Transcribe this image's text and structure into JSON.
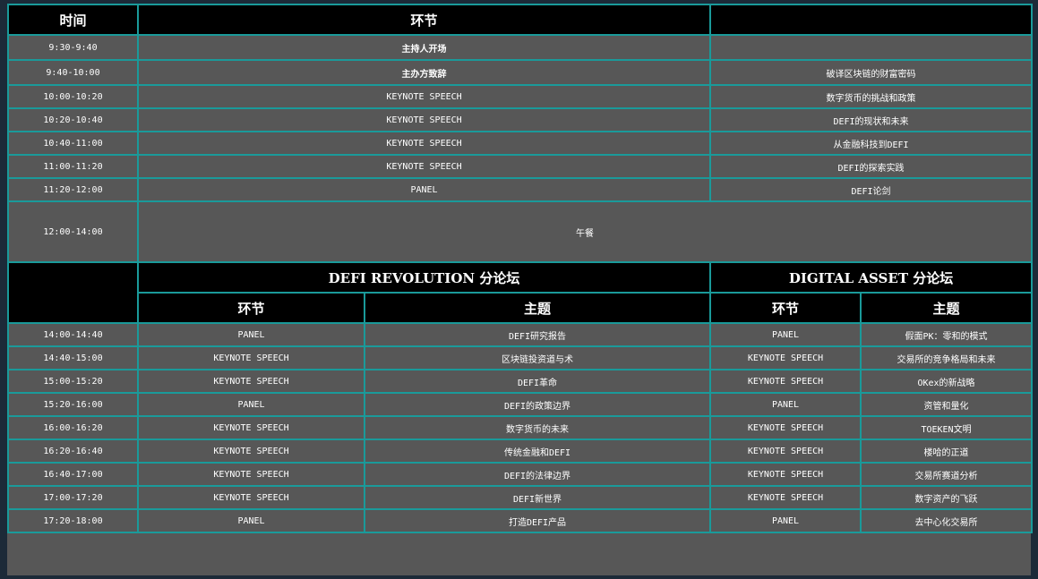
{
  "header": {
    "time": "时间",
    "segment": "环节",
    "topic": ""
  },
  "morning": [
    {
      "time": "9:30-9:40",
      "segment": "主持人开场",
      "topic": ""
    },
    {
      "time": "9:40-10:00",
      "segment": "主办方致辞",
      "topic": "破译区块链的财富密码"
    },
    {
      "time": "10:00-10:20",
      "segment": "KEYNOTE SPEECH",
      "topic": "数字货币的挑战和政策"
    },
    {
      "time": "10:20-10:40",
      "segment": "KEYNOTE SPEECH",
      "topic": "DEFI的现状和未来"
    },
    {
      "time": "10:40-11:00",
      "segment": "KEYNOTE SPEECH",
      "topic": "从金融科技到DEFI"
    },
    {
      "time": "11:00-11:20",
      "segment": "KEYNOTE SPEECH",
      "topic": "DEFI的探索实践"
    },
    {
      "time": "11:20-12:00",
      "segment": "PANEL",
      "topic": "DEFI论剑"
    }
  ],
  "lunch": {
    "time": "12:00-14:00",
    "label": "午餐"
  },
  "forums": {
    "left_title": "DEFI REVOLUTION 分论坛",
    "right_title": "DIGITAL  ASSET  分论坛",
    "segment_label": "环节",
    "topic_label": "主题"
  },
  "afternoon": [
    {
      "time": "14:00-14:40",
      "l_seg": "PANEL",
      "l_topic": "DEFI研究报告",
      "r_seg": "PANEL",
      "r_topic": "假面PK：零和的模式"
    },
    {
      "time": "14:40-15:00",
      "l_seg": "KEYNOTE SPEECH",
      "l_topic": "区块链投资道与术",
      "r_seg": "KEYNOTE SPEECH",
      "r_topic": "交易所的竞争格局和未来"
    },
    {
      "time": "15:00-15:20",
      "l_seg": "KEYNOTE SPEECH",
      "l_topic": "DEFI革命",
      "r_seg": "KEYNOTE SPEECH",
      "r_topic": "OKex的新战略"
    },
    {
      "time": "15:20-16:00",
      "l_seg": "PANEL",
      "l_topic": "DEFI的政策边界",
      "r_seg": "PANEL",
      "r_topic": "资管和量化"
    },
    {
      "time": "16:00-16:20",
      "l_seg": "KEYNOTE SPEECH",
      "l_topic": "数字货币的未来",
      "r_seg": "KEYNOTE SPEECH",
      "r_topic": "TOEKEN文明"
    },
    {
      "time": "16:20-16:40",
      "l_seg": "KEYNOTE SPEECH",
      "l_topic": "传统金融和DEFI",
      "r_seg": "KEYNOTE SPEECH",
      "r_topic": "楼哈的正道"
    },
    {
      "time": "16:40-17:00",
      "l_seg": "KEYNOTE SPEECH",
      "l_topic": "DEFI的法律边界",
      "r_seg": "KEYNOTE SPEECH",
      "r_topic": "交易所赛道分析"
    },
    {
      "time": "17:00-17:20",
      "l_seg": "KEYNOTE SPEECH",
      "l_topic": "DEFI新世界",
      "r_seg": "KEYNOTE SPEECH",
      "r_topic": "数字资产的飞跃"
    },
    {
      "time": "17:20-18:00",
      "l_seg": "PANEL",
      "l_topic": "打造DEFI产品",
      "r_seg": "PANEL",
      "r_topic": "去中心化交易所"
    }
  ]
}
